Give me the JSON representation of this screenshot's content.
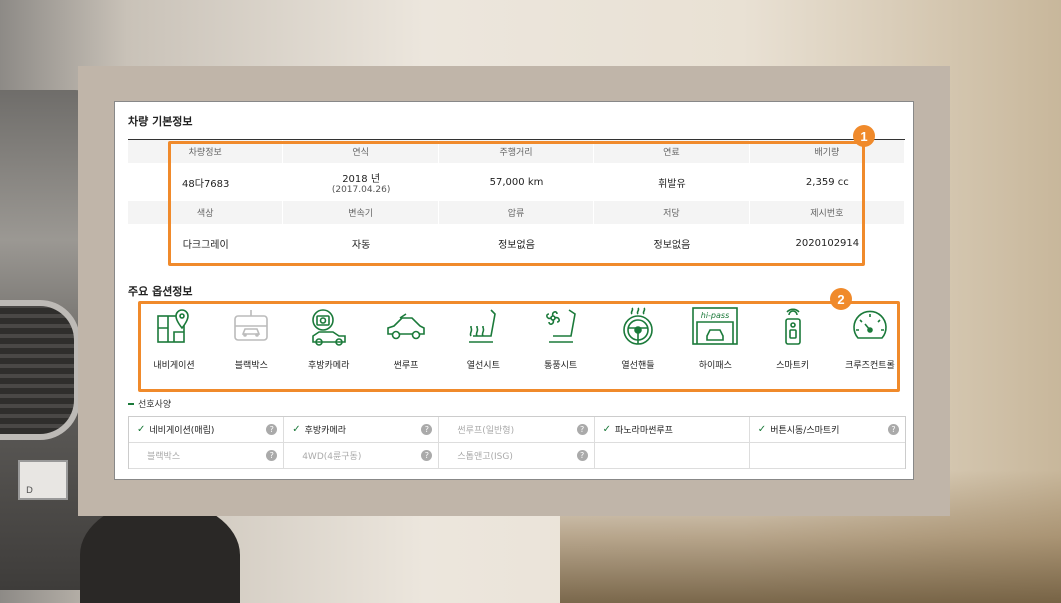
{
  "background": {
    "plate_text": "D"
  },
  "colors": {
    "accent_green": "#1b7a3a",
    "highlight_orange": "#f08a2b"
  },
  "basic_info": {
    "title": "차량 기본정보",
    "rows": [
      {
        "headers": [
          "차량정보",
          "연식",
          "주행거리",
          "연료",
          "배기량"
        ],
        "values": [
          {
            "main": "48다7683"
          },
          {
            "main": "2018 년",
            "sub": "(2017.04.26)"
          },
          {
            "main": "57,000 km"
          },
          {
            "main": "휘발유"
          },
          {
            "main": "2,359 cc"
          }
        ]
      },
      {
        "headers": [
          "색상",
          "변속기",
          "압류",
          "저당",
          "제시번호"
        ],
        "values": [
          {
            "main": "다크그레이"
          },
          {
            "main": "자동"
          },
          {
            "main": "정보없음"
          },
          {
            "main": "정보없음"
          },
          {
            "main": "2020102914"
          }
        ]
      }
    ]
  },
  "badges": [
    "1",
    "2"
  ],
  "options": {
    "title": "주요 옵션정보",
    "items": [
      {
        "label": "내비게이션",
        "icon": "navigation-map-icon",
        "active": true
      },
      {
        "label": "블랙박스",
        "icon": "dashcam-icon",
        "active": false
      },
      {
        "label": "후방카메라",
        "icon": "rear-camera-icon",
        "active": true
      },
      {
        "label": "썬루프",
        "icon": "sunroof-car-icon",
        "active": true
      },
      {
        "label": "열선시트",
        "icon": "heated-seat-icon",
        "active": true
      },
      {
        "label": "통풍시트",
        "icon": "ventilated-seat-icon",
        "active": true
      },
      {
        "label": "열선핸들",
        "icon": "heated-steering-wheel-icon",
        "active": true
      },
      {
        "label": "하이패스",
        "icon": "hipass-icon",
        "icon_text": "hi-pass",
        "active": true
      },
      {
        "label": "스마트키",
        "icon": "smart-key-icon",
        "active": true
      },
      {
        "label": "크루즈컨트롤",
        "icon": "cruise-control-gauge-icon",
        "active": true
      }
    ]
  },
  "preferences": {
    "title": "선호사양",
    "items": [
      {
        "label": "네비게이션(매립)",
        "checked": true
      },
      {
        "label": "후방카메라",
        "checked": true
      },
      {
        "label": "썬루프(일반형)",
        "checked": false
      },
      {
        "label": "파노라마썬루프",
        "checked": true
      },
      {
        "label": "버튼시동/스마트키",
        "checked": true
      },
      {
        "label": "블랙박스",
        "checked": false
      },
      {
        "label": "4WD(4륜구동)",
        "checked": false
      },
      {
        "label": "스톱앤고(ISG)",
        "checked": false
      },
      {
        "label": "",
        "checked": false
      },
      {
        "label": "",
        "checked": false
      }
    ],
    "check_glyph": "✓",
    "help_glyph": "?"
  }
}
